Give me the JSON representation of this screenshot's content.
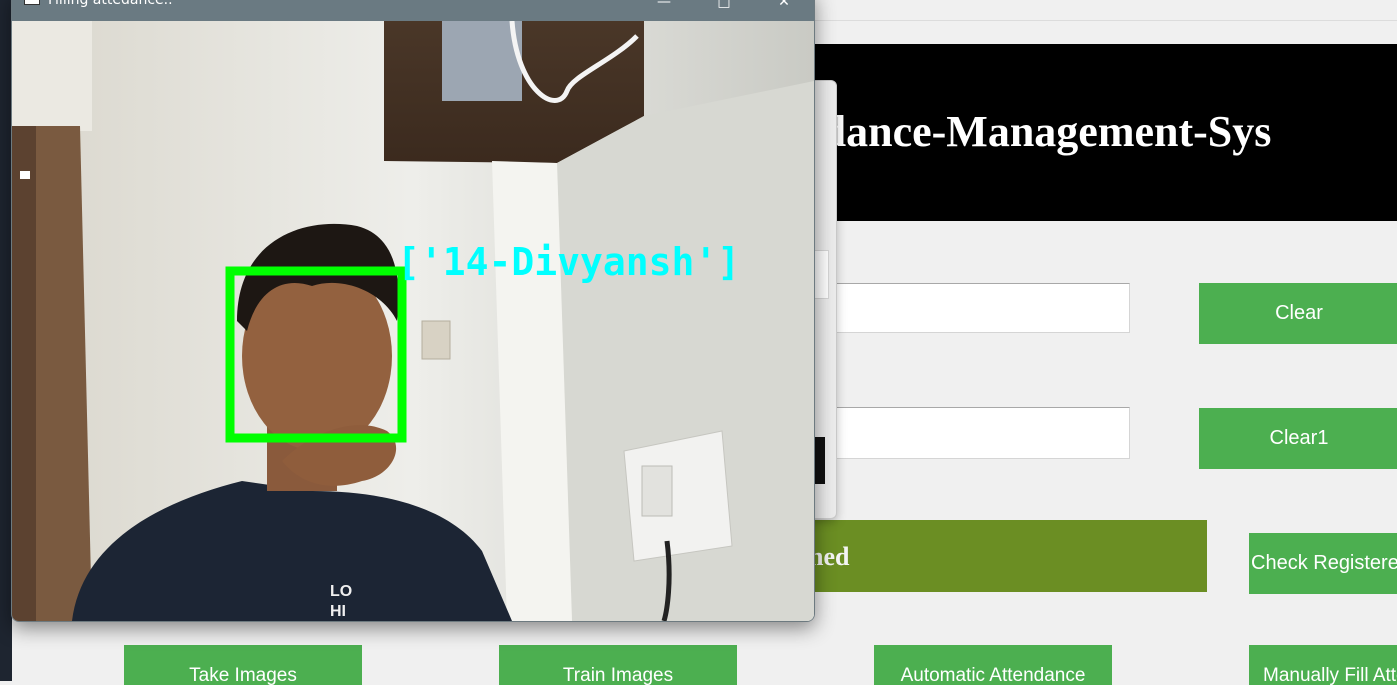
{
  "app": {
    "banner_title": "Attendance-Management-System",
    "banner_visible": "tendance-Management-Sys",
    "olive_label": "ned",
    "buttons": {
      "clear": "Clear",
      "clear1": "Clear1",
      "check_registered": "Check Registered",
      "take_images": "Take Images",
      "train_images": "Train Images",
      "automatic_attendance": "Automatic Attendance",
      "manual_fill": "Manually Fill Attendance"
    }
  },
  "camera_window": {
    "title": "Filling attedance..",
    "recognized_label": "['14-Divyansh']",
    "box_color": "#00ff00",
    "label_color": "#00ffff"
  },
  "colors": {
    "button_green": "#4caf50",
    "olive": "#6b8e23",
    "banner_bg": "#000000"
  }
}
